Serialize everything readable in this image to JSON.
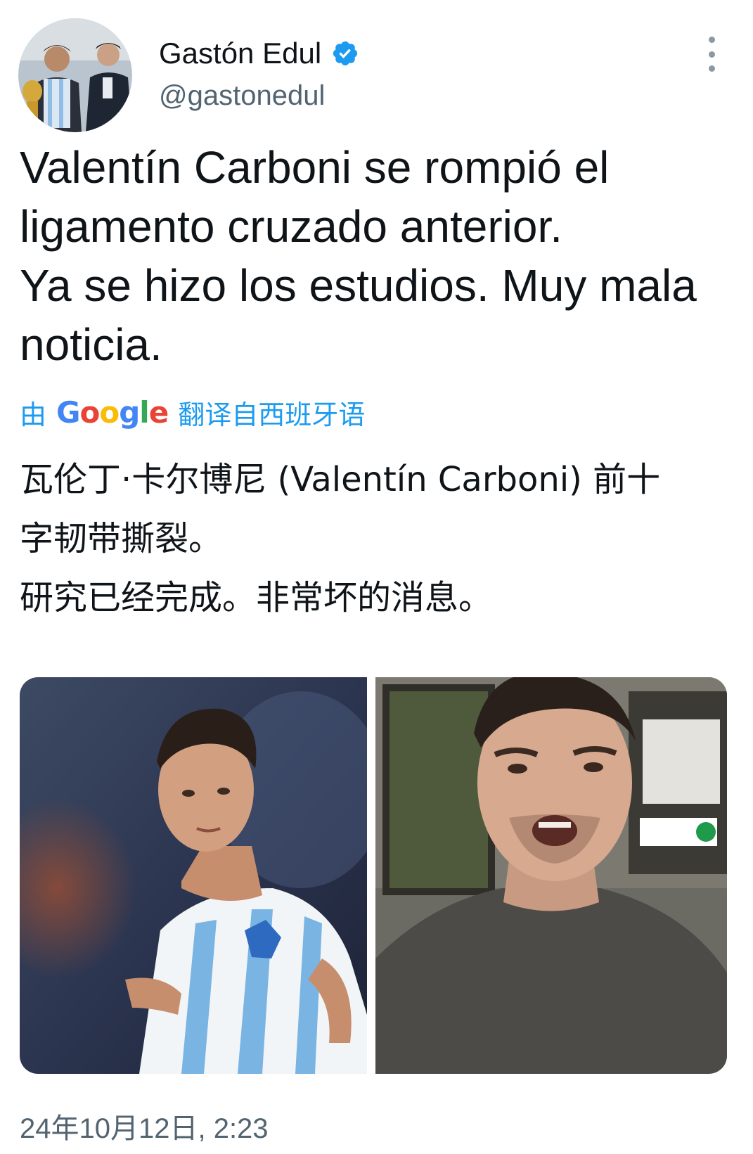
{
  "author": {
    "display_name": "Gastón Edul",
    "handle": "@gastonedul",
    "verified": true,
    "verified_color": "#1d9bf0"
  },
  "tweet": {
    "lines": [
      "Valentín Carboni se rompió el",
      "ligamento cruzado anterior.",
      "Ya se hizo los estudios. Muy mala",
      "noticia."
    ]
  },
  "translation": {
    "prefix": "由",
    "provider": "Google",
    "label": "翻译自西班牙语",
    "lines": [
      "瓦伦丁·卡尔博尼 (Valentín Carboni) 前十",
      "字韧带撕裂。",
      "研究已经完成。非常坏的消息。"
    ]
  },
  "media": [
    {
      "name": "photo-football-player",
      "kind": "image"
    },
    {
      "name": "photo-reporter-video",
      "kind": "image"
    }
  ],
  "timestamp": "24年10月12日, 2:23",
  "colors": {
    "accent": "#1d9bf0",
    "text": "#0f1419",
    "secondary": "#536471"
  },
  "icons": [
    "verified-badge-icon",
    "more-options-icon"
  ]
}
